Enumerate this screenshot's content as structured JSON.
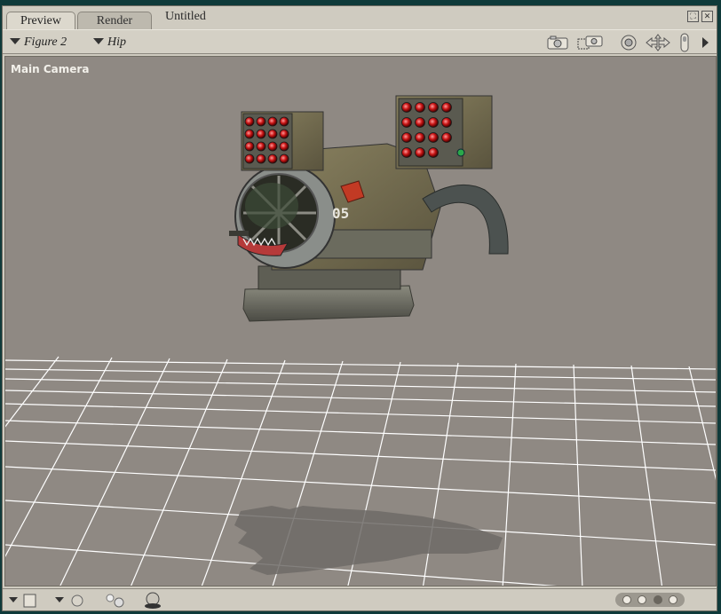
{
  "tabs": [
    {
      "label": "Preview",
      "active": true
    },
    {
      "label": "Render",
      "active": false
    }
  ],
  "document_title": "Untitled",
  "figure_selector": {
    "value": "Figure 2"
  },
  "part_selector": {
    "value": "Hip"
  },
  "viewport": {
    "camera_label": "Main Camera",
    "background_color": "#8f8983",
    "grid_color": "#ffffff"
  },
  "toolbar_icons": [
    "camera-icon",
    "camera-select-icon",
    "rotate-icon",
    "move-icon",
    "scale-icon",
    "expand-arrow-icon"
  ],
  "window_controls": [
    "maximize-icon",
    "close-icon"
  ],
  "bottom_controls": [
    "display-style-dropdown-icon",
    "shading-icon",
    "light-icon",
    "multi-light-icon",
    "render-light-icon"
  ],
  "bottom_dots": {
    "count": 4,
    "active_index": 2
  }
}
